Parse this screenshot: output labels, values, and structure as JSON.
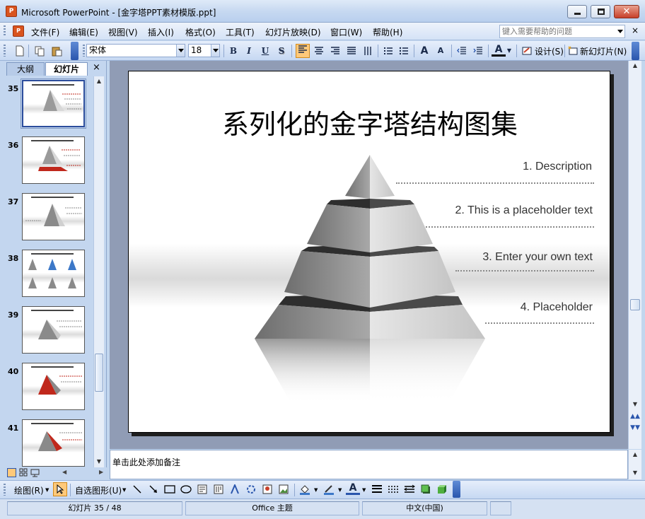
{
  "window": {
    "title": "Microsoft PowerPoint - [金字塔PPT素材模版.ppt]",
    "app_icon": "powerpoint-icon",
    "minimize_icon": "minimize-icon",
    "maximize_icon": "maximize-icon",
    "close_icon": "close-icon"
  },
  "menubar": {
    "items": [
      "文件(F)",
      "编辑(E)",
      "视图(V)",
      "插入(I)",
      "格式(O)",
      "工具(T)",
      "幻灯片放映(D)",
      "窗口(W)",
      "帮助(H)"
    ],
    "help_placeholder": "键入需要帮助的问题",
    "close_doc": "×"
  },
  "toolbar": {
    "font_name": "宋体",
    "font_size": "18",
    "bold": "B",
    "italic": "I",
    "underline": "U",
    "shadow": "S",
    "design_label": "设计(S)",
    "new_slide_label": "新幻灯片(N)",
    "font_color_label": "A",
    "increase_font": "A",
    "decrease_font": "A"
  },
  "left_pane": {
    "tabs": [
      "大纲",
      "幻灯片"
    ],
    "close": "×",
    "thumbnails": [
      {
        "number": "35",
        "selected": true
      },
      {
        "number": "36",
        "selected": false
      },
      {
        "number": "37",
        "selected": false
      },
      {
        "number": "38",
        "selected": false
      },
      {
        "number": "39",
        "selected": false
      },
      {
        "number": "40",
        "selected": false
      },
      {
        "number": "41",
        "selected": false
      }
    ]
  },
  "slide": {
    "title": "系列化的金字塔结构图集",
    "descriptions": [
      "1. Description",
      "2. This is a placeholder text",
      "3. Enter your own text",
      "4. Placeholder"
    ]
  },
  "notes": {
    "placeholder": "单击此处添加备注"
  },
  "drawing_toolbar": {
    "draw_label": "绘图(R)",
    "autoshapes_label": "自选图形(U)"
  },
  "statusbar": {
    "slide_position": "幻灯片 35 / 48",
    "theme": "Office 主题",
    "language": "中文(中国)"
  },
  "colors": {
    "accent": "#ffc97a",
    "chrome": "#c7d9f1",
    "slide_workspace": "#909cb5",
    "thumb_red": "#c0281c",
    "thumb_blue": "#3c78c8"
  }
}
